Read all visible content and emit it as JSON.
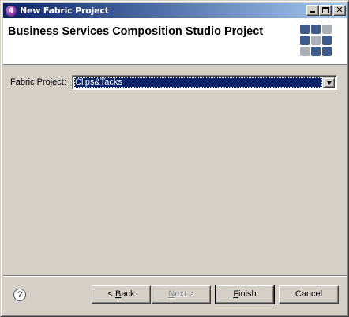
{
  "window": {
    "title": "New Fabric Project"
  },
  "titlebar": {
    "icon": "fabric-app-icon",
    "app_icon_glyph": "4",
    "minimize_icon": "minimize-icon",
    "maximize_icon": "maximize-icon",
    "close_icon": "close-icon",
    "close_glyph": "✕"
  },
  "banner": {
    "title": "Business Services Composition Studio Project",
    "logo_icon": "tile-grid-logo",
    "logo_colors": [
      "#3c5a8c",
      "#a9b0b8"
    ]
  },
  "form": {
    "fabric_project_label": "Fabric Project:",
    "fabric_project_value": "Clips&Tacks"
  },
  "help": {
    "icon": "help-icon",
    "glyph": "?"
  },
  "buttons": {
    "back_prefix": "< ",
    "back_mnemonic": "B",
    "back_rest": "ack",
    "next_mnemonic": "N",
    "next_rest": "ext >",
    "finish_mnemonic": "F",
    "finish_rest": "inish",
    "cancel": "Cancel"
  }
}
